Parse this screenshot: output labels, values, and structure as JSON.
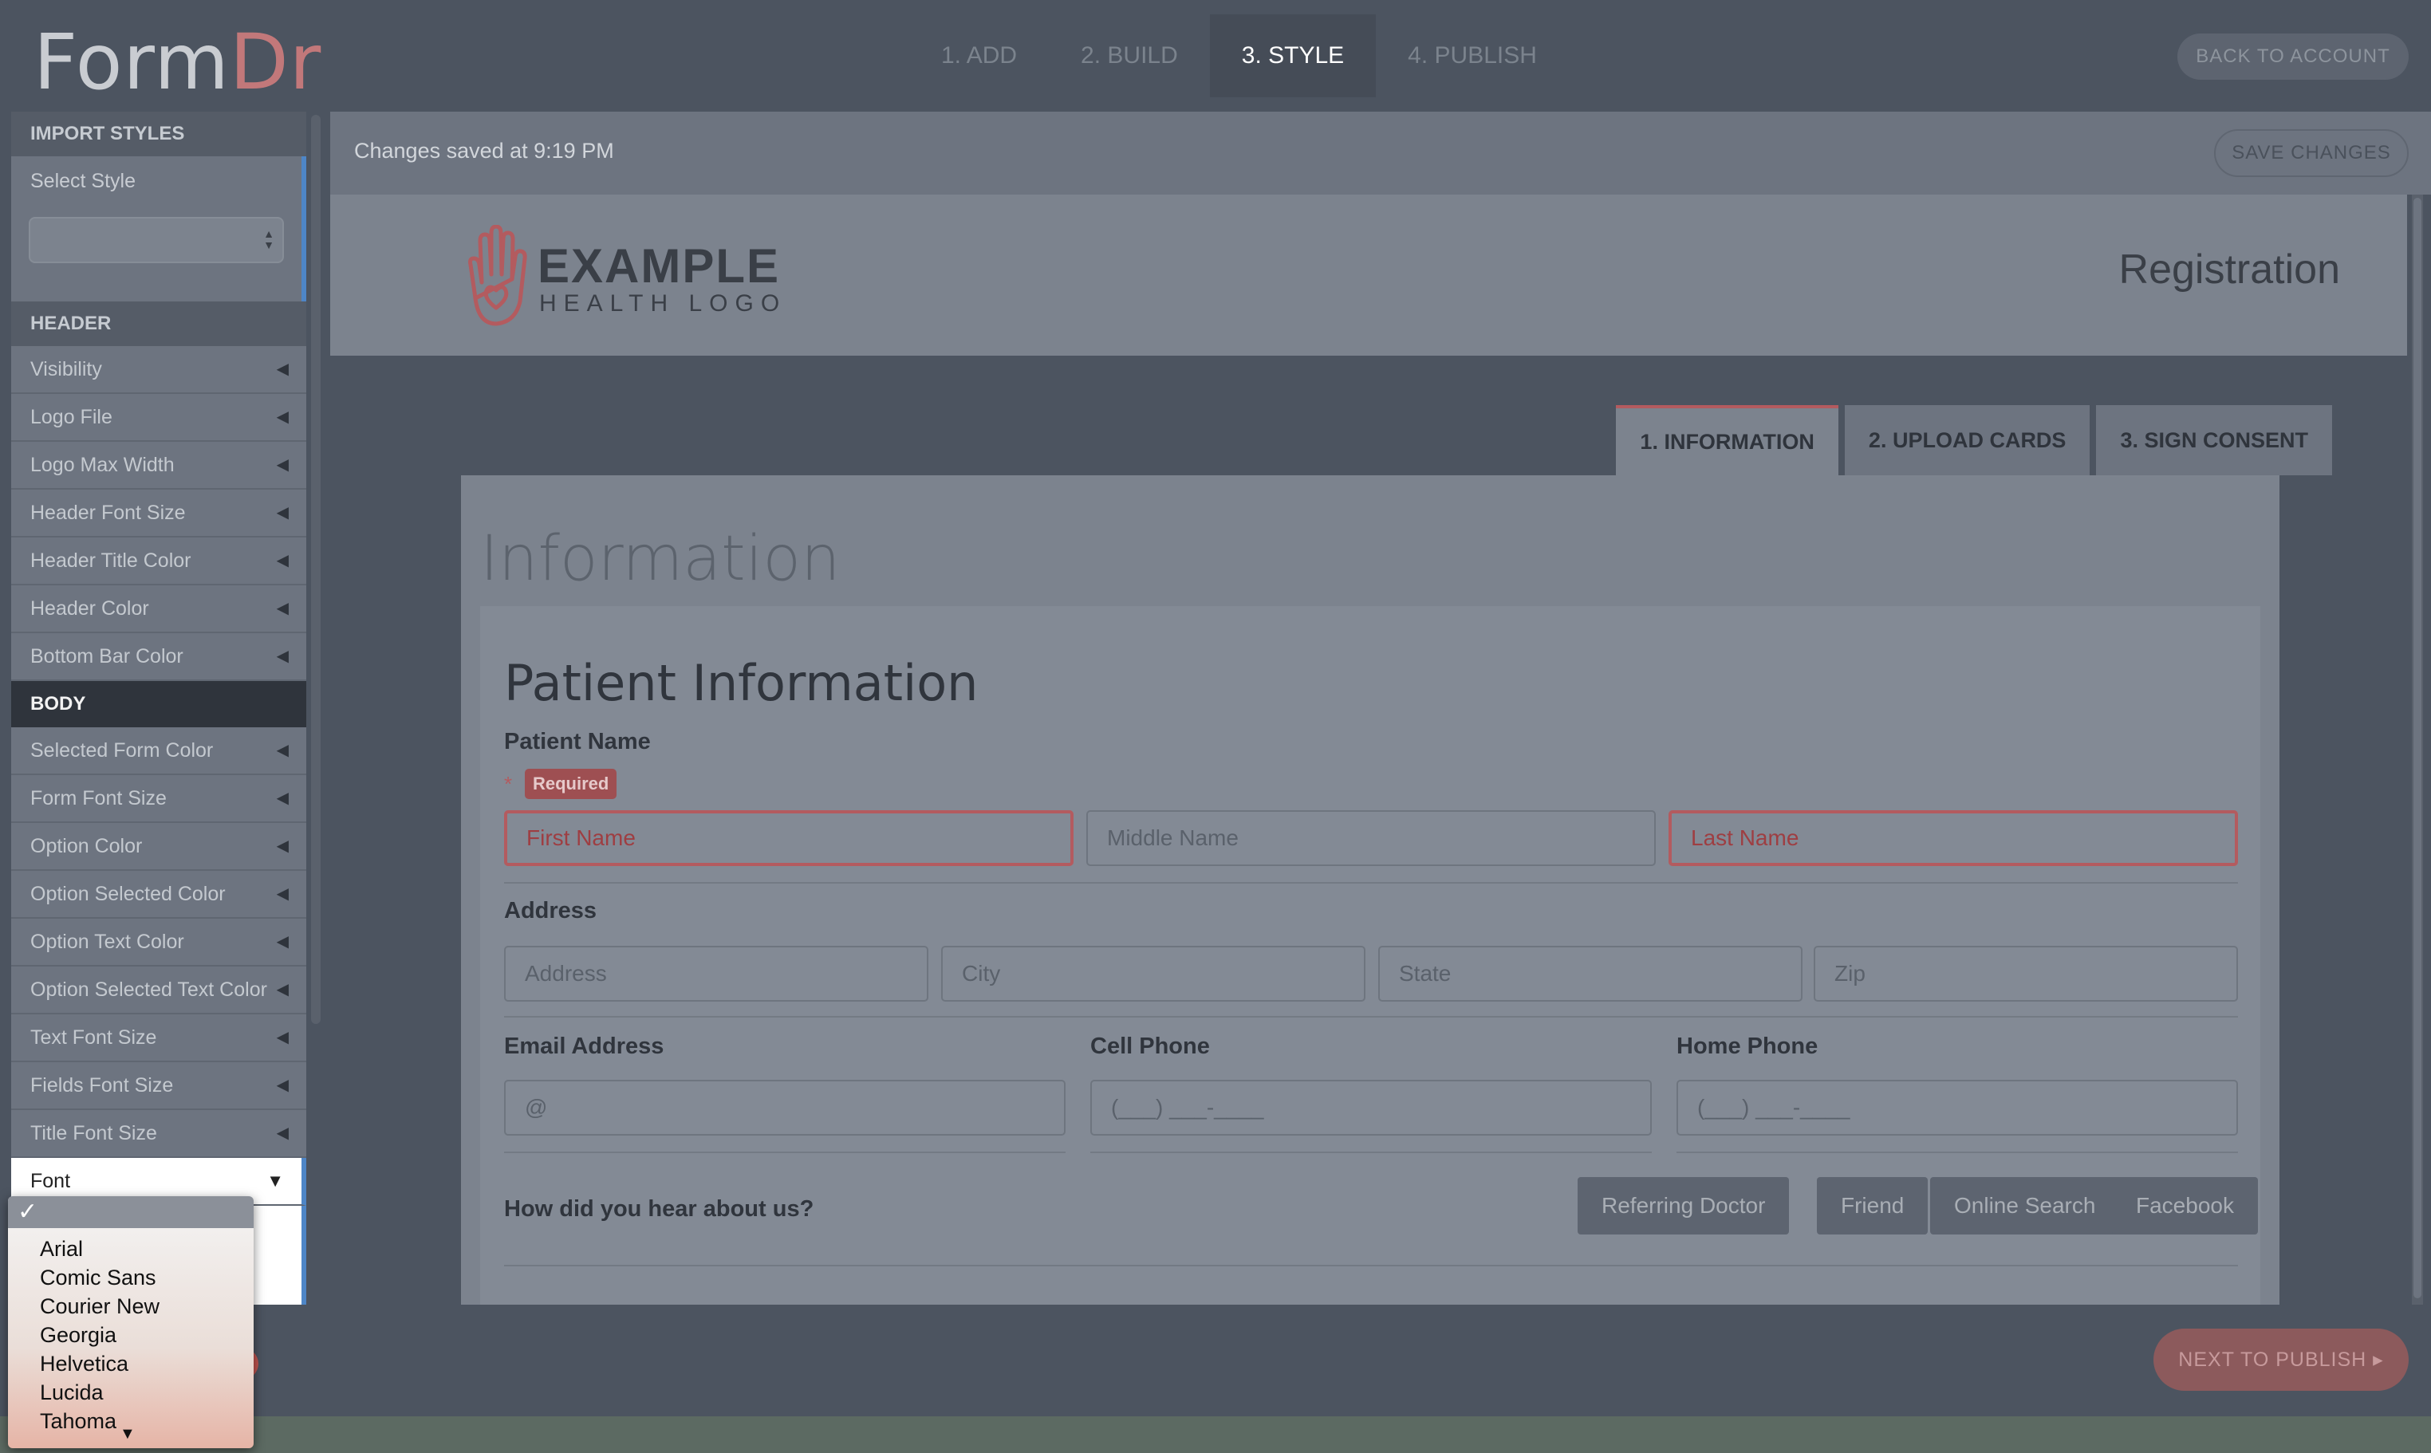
{
  "app": {
    "logo_form": "Form",
    "logo_dr": "Dr",
    "steps": [
      "1. ADD",
      "2. BUILD",
      "3. STYLE",
      "4. PUBLISH"
    ],
    "active_step": "3. STYLE",
    "back_button": "BACK TO ACCOUNT"
  },
  "sidebar": {
    "import_section": "IMPORT STYLES",
    "select_style_label": "Select Style",
    "select_style_value": "",
    "header_section": "HEADER",
    "header_items": [
      "Visibility",
      "Logo File",
      "Logo Max Width",
      "Header Font Size",
      "Header Title Color",
      "Header Color",
      "Bottom Bar Color"
    ],
    "body_section": "BODY",
    "body_items": [
      "Selected Form Color",
      "Form Font Size",
      "Option Color",
      "Option Selected Color",
      "Option Text Color",
      "Option Selected Text Color",
      "Text Font Size",
      "Fields Font Size",
      "Title Font Size"
    ],
    "font_item": "Font"
  },
  "font_dropdown": {
    "selected_mark": "✓",
    "options": [
      "Arial",
      "Comic Sans",
      "Courier New",
      "Georgia",
      "Helvetica",
      "Lucida",
      "Tahoma"
    ]
  },
  "savebar": {
    "status": "Changes saved at 9:19 PM",
    "save_button": "SAVE CHANGES"
  },
  "form_header": {
    "logo_line1": "EXAMPLE",
    "logo_line2": "HEALTH LOGO",
    "title": "Registration"
  },
  "form": {
    "tabs": [
      "1. INFORMATION",
      "2. UPLOAD CARDS",
      "3. SIGN CONSENT"
    ],
    "page_title": "Information",
    "section_title": "Patient Information",
    "patient_name_label": "Patient Name",
    "required_star": "*",
    "required_badge": "Required",
    "name_placeholders": [
      "First Name",
      "Middle Name",
      "Last Name"
    ],
    "address_label": "Address",
    "address_placeholders": [
      "Address",
      "City",
      "State",
      "Zip"
    ],
    "email_label": "Email Address",
    "email_placeholder": "@",
    "cell_label": "Cell Phone",
    "cell_placeholder": "(___) ___-____",
    "home_label": "Home Phone",
    "home_placeholder": "(___) ___-____",
    "hear_label": "How did you hear about us?",
    "hear_options": [
      "Referring Doctor",
      "Friend",
      "Online Search",
      "Facebook"
    ]
  },
  "bottombar": {
    "next_button": "NEXT TO PUBLISH ▸"
  },
  "colors": {
    "accent_red": "#b35b5f",
    "selected_blue": "#4e86c7",
    "overlay_dark": "#4c5460"
  }
}
